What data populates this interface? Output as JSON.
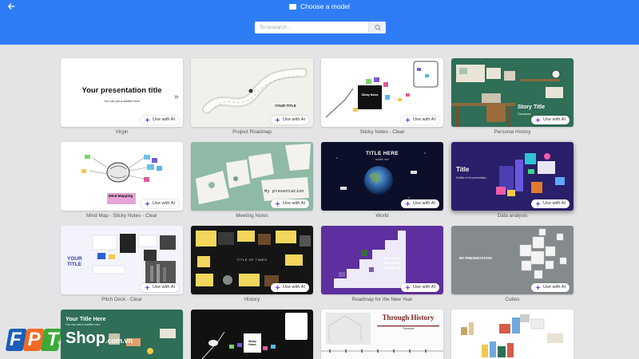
{
  "header": {
    "title": "Choose a model",
    "search_placeholder": "To research...",
    "bg_color": "#2f7df6"
  },
  "icons": {
    "back": "arrow-left-icon",
    "title": "presentation-icon",
    "search": "search-icon",
    "ai": "sparkle-icon"
  },
  "ai_label": "Use with AI",
  "cards": [
    {
      "caption": "Virgin",
      "title": "Your presentation title",
      "subtitle": "You can put a subtitle here"
    },
    {
      "caption": "Project Roadmap",
      "title": "YOUR TITLE"
    },
    {
      "caption": "Sticky Notes - Clear",
      "title": "Sticky Notes"
    },
    {
      "caption": "Personal History",
      "title": "Story Title",
      "subtitle": "Ciaospace"
    },
    {
      "caption": "Mind Map - Sticky Notes - Clear",
      "title": "Mind Mapping"
    },
    {
      "caption": "Meeting Notes",
      "title": "My presentation"
    },
    {
      "caption": "World",
      "title": "TITLE HERE",
      "subtitle": "subtitle here"
    },
    {
      "caption": "Data analysis",
      "title": "Title",
      "subtitle": "Subtitle of the presentation"
    },
    {
      "caption": "Pitch Deck - Clear",
      "title": "YOUR TITLE"
    },
    {
      "caption": "History",
      "title": "TITLE OF TIMES"
    },
    {
      "caption": "Roadmap for the New Year",
      "title": "New Year Business Roadmap"
    },
    {
      "caption": "Cubes",
      "title": "MY PRESENTATION"
    },
    {
      "caption": "",
      "title": "Your Title Here",
      "subtitle": "You can add a subtitle here"
    },
    {
      "caption": "",
      "title": "Sticky Notes"
    },
    {
      "caption": "",
      "title": "Through History",
      "subtitle": "Timeline"
    },
    {
      "caption": "",
      "title": ""
    }
  ],
  "watermark": {
    "brand": "FPT",
    "shop": "Shop",
    "domain": ".com.vn",
    "registered": "®"
  }
}
